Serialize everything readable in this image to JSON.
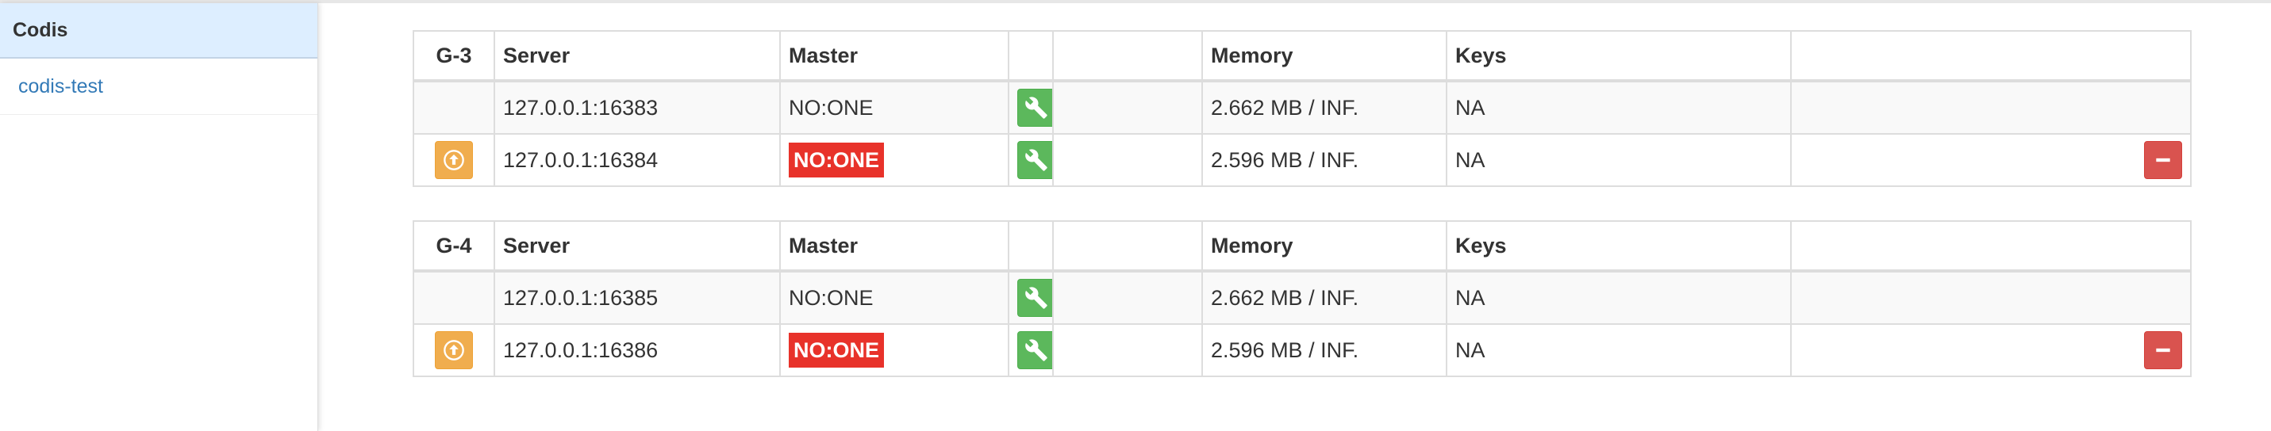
{
  "sidebar": {
    "title": "Codis",
    "items": [
      {
        "label": "codis-test"
      }
    ]
  },
  "colors": {
    "sidebar_header_bg": "#ddeeff",
    "link": "#337ab7",
    "master_badge": "#e8322a",
    "action_green": "#5cb85c",
    "promote_orange": "#f0ad4e",
    "remove_red": "#d9534f"
  },
  "groups": [
    {
      "id": "G-3",
      "columns": {
        "server": "Server",
        "master": "Master",
        "memory": "Memory",
        "keys": "Keys"
      },
      "rows": [
        {
          "server": "127.0.0.1:16383",
          "master": "NO:ONE",
          "memory": "2.662 MB / INF.",
          "keys": "NA",
          "icons": [
            "wrench-icon"
          ]
        },
        {
          "server": "127.0.0.1:16384",
          "master": "NO:ONE",
          "memory": "2.596 MB / INF.",
          "keys": "NA",
          "icons": [
            "promote-icon",
            "wrench-icon",
            "minus-icon"
          ]
        }
      ]
    },
    {
      "id": "G-4",
      "columns": {
        "server": "Server",
        "master": "Master",
        "memory": "Memory",
        "keys": "Keys"
      },
      "rows": [
        {
          "server": "127.0.0.1:16385",
          "master": "NO:ONE",
          "memory": "2.662 MB / INF.",
          "keys": "NA",
          "icons": [
            "wrench-icon"
          ]
        },
        {
          "server": "127.0.0.1:16386",
          "master": "NO:ONE",
          "memory": "2.596 MB / INF.",
          "keys": "NA",
          "icons": [
            "promote-icon",
            "wrench-icon",
            "minus-icon"
          ]
        }
      ]
    }
  ]
}
